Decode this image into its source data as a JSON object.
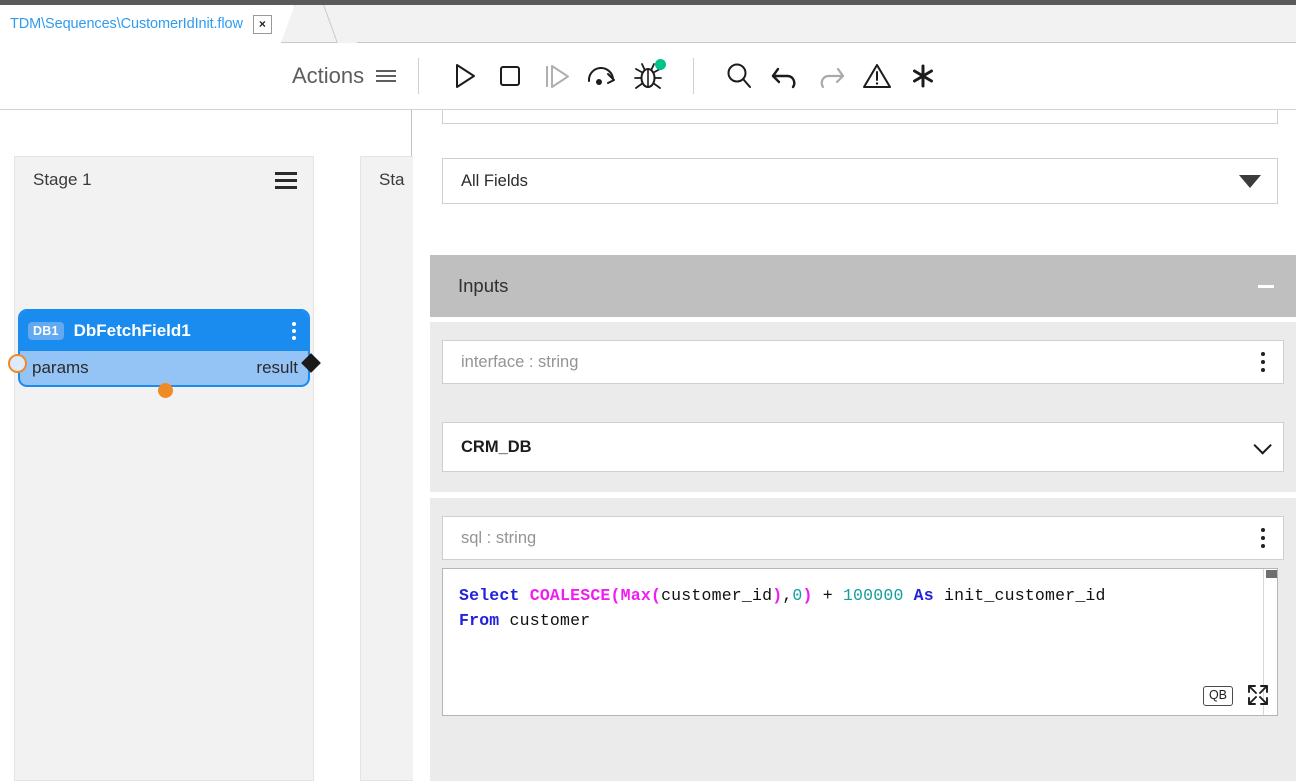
{
  "window": {
    "tab": {
      "label": "TDM\\Sequences\\CustomerIdInit.flow",
      "close_glyph": "×"
    }
  },
  "toolbar": {
    "actions_label": "Actions",
    "icons": [
      {
        "name": "menu-icon",
        "title": "Menu"
      },
      {
        "name": "run-icon",
        "title": "Run"
      },
      {
        "name": "stop-icon",
        "title": "Stop"
      },
      {
        "name": "step-into-icon",
        "title": "Step"
      },
      {
        "name": "step-over-icon",
        "title": "Step Over"
      },
      {
        "name": "debug-icon",
        "title": "Debug",
        "badge_color": "#00c389"
      },
      {
        "name": "search-icon",
        "title": "Search"
      },
      {
        "name": "undo-icon",
        "title": "Undo"
      },
      {
        "name": "redo-icon",
        "title": "Redo"
      },
      {
        "name": "warning-icon",
        "title": "Warnings"
      },
      {
        "name": "asterisk-icon",
        "title": "Asterisk"
      }
    ]
  },
  "canvas": {
    "stages": [
      {
        "title": "Stage 1"
      },
      {
        "title": "Sta"
      }
    ],
    "node": {
      "badge": "DB1",
      "name": "DbFetchField1",
      "input_port": "params",
      "output_port": "result",
      "header_color": "#1a8cf0",
      "body_color": "#94c3f5",
      "port_accent": "#f08a25"
    }
  },
  "properties": {
    "fields_select": {
      "value": "All Fields"
    },
    "inputs_section": {
      "title": "Inputs",
      "collapsed": false
    },
    "interface_field": {
      "label": "interface : string",
      "value": "CRM_DB"
    },
    "sql_field": {
      "label": "sql : string",
      "code_lines": [
        [
          {
            "t": "Select ",
            "c": "kw"
          },
          {
            "t": "COALESCE",
            "c": "fn"
          },
          {
            "t": "(",
            "c": "fn"
          },
          {
            "t": "Max",
            "c": "fn"
          },
          {
            "t": "(",
            "c": "fn"
          },
          {
            "t": "customer_id",
            "c": "pln"
          },
          {
            "t": ")",
            "c": "fn"
          },
          {
            "t": ",",
            "c": "pln"
          },
          {
            "t": "0",
            "c": "num"
          },
          {
            "t": ")",
            "c": "fn"
          },
          {
            "t": " + ",
            "c": "pln"
          },
          {
            "t": "100000",
            "c": "num"
          },
          {
            "t": " As ",
            "c": "kw"
          },
          {
            "t": "init_customer_id",
            "c": "pln"
          }
        ],
        [
          {
            "t": "From ",
            "c": "kw"
          },
          {
            "t": "customer",
            "c": "pln"
          }
        ]
      ],
      "query_builder_label": "QB"
    }
  }
}
